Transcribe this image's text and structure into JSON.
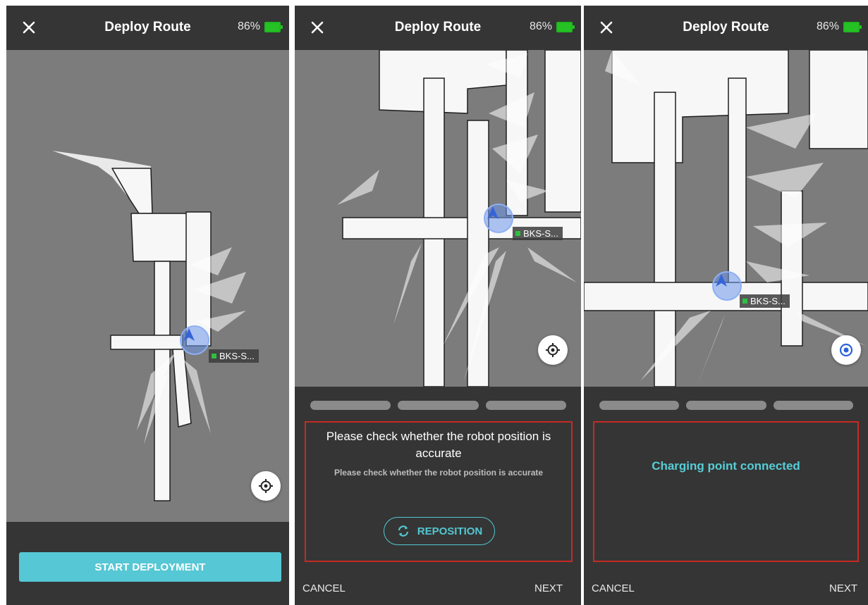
{
  "screens": [
    {
      "title": "Deploy Route",
      "battery": "86%",
      "robot_label": "BKS-S...",
      "primary_action": "START DEPLOYMENT"
    },
    {
      "title": "Deploy Route",
      "battery": "86%",
      "robot_label": "BKS-S...",
      "heading": "Please check whether the robot position is accurate",
      "subtext": "Please check whether the robot position is accurate",
      "reposition_label": "REPOSITION",
      "cancel_label": "CANCEL",
      "next_label": "NEXT"
    },
    {
      "title": "Deploy Route",
      "battery": "86%",
      "robot_label": "BKS-S...",
      "status": "Charging point connected",
      "cancel_label": "CANCEL",
      "next_label": "NEXT"
    }
  ],
  "icons": {
    "close": "close-icon",
    "battery": "battery-icon",
    "locate": "crosshair-icon",
    "robot": "navigation-arrow-icon",
    "reposition": "refresh-icon"
  },
  "colors": {
    "accent": "#56c7d4",
    "map_background": "#7c7c7c",
    "map_floor": "#f7f7f7",
    "panel": "#353535",
    "highlight_border": "#c72a24",
    "battery": "#25c125"
  }
}
